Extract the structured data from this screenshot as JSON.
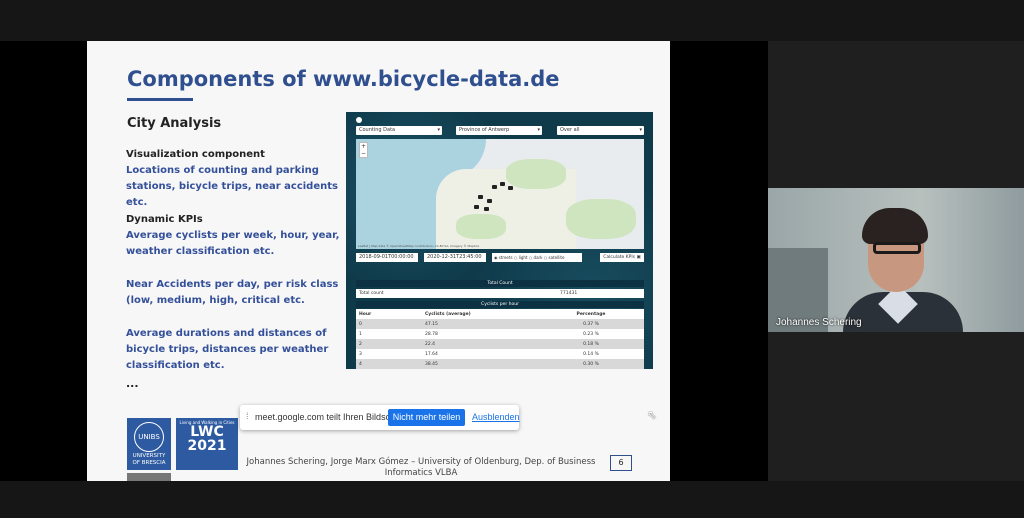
{
  "slide": {
    "title": "Components of www.bicycle-data.de",
    "section": "City Analysis",
    "blocks": [
      {
        "heading": "Visualization component",
        "text": "Locations of counting and parking stations, bicycle trips, near accidents etc."
      },
      {
        "heading": "Dynamic KPIs",
        "text": "Average cyclists per week, hour, year, weather classification etc."
      },
      {
        "heading": "",
        "text": "Near Accidents per day, per risk class (low, medium, high, critical etc."
      },
      {
        "heading": "",
        "text": "Average durations and distances of bicycle trips, distances per weather classification etc."
      }
    ],
    "ellipsis": "...",
    "footer": "Johannes Schering, Jorge Marx Gómez – University of Oldenburg, Dep. of Business Informatics VLBA",
    "page_number": "6",
    "logos": {
      "unibs_seal": "UNIBS",
      "unibs_line1": "UNIVERSITY",
      "unibs_line2": "OF BRESCIA",
      "lwc_small": "Living and Walking in Cities",
      "lwc_big1": "LWC",
      "lwc_big2": "2021"
    }
  },
  "dashboard": {
    "select1": "Counting Data",
    "select2": "Province of Antwerp",
    "select3": "Over all",
    "date_from": "2018-09-01T00:00:00",
    "date_to": "2020-12-31T23:45:00",
    "radios": [
      "streets",
      "light",
      "dark",
      "satellite"
    ],
    "calc_button": "Calculate KPIs",
    "zoom_in": "+",
    "zoom_out": "−",
    "attribution": "Leaflet | Map data © OpenStreetMap contributors, CC-BY-SA, Imagery © Mapbox",
    "total_count_header": "Total Count",
    "total_count_label": "Total count",
    "total_count_value": "771431",
    "cyclists_header": "Cyclists per hour",
    "table_columns": [
      "Hour",
      "Cyclists (average)",
      "Percentage"
    ],
    "table_rows": [
      [
        "0",
        "47.15",
        "0.37 %"
      ],
      [
        "1",
        "28.78",
        "0.23 %"
      ],
      [
        "2",
        "22.4",
        "0.18 %"
      ],
      [
        "3",
        "17.64",
        "0.14 %"
      ],
      [
        "4",
        "38.45",
        "0.30 %"
      ]
    ]
  },
  "share_banner": {
    "message": "meet.google.com teilt Ihren Bildschirm.",
    "stop_label": "Nicht mehr teilen",
    "hide_label": "Ausblenden",
    "grip": "⁞"
  },
  "participant": {
    "name": "Johannes Schering"
  },
  "cursor_glyph": "⇖"
}
